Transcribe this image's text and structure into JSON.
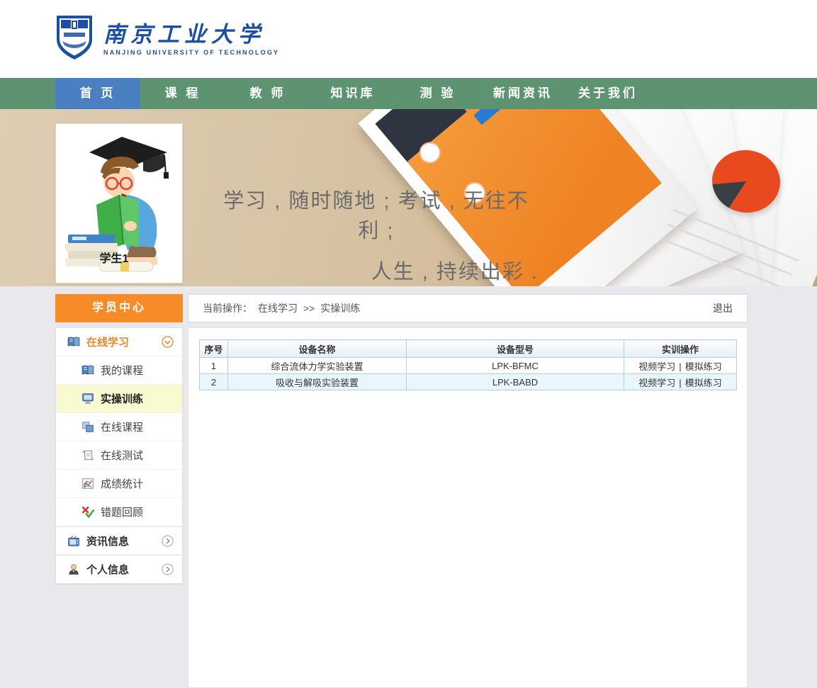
{
  "header": {
    "logo_cn": "南京工业大学",
    "logo_en": "NANJING UNIVERSITY OF TECHNOLOGY"
  },
  "nav": {
    "items": [
      {
        "label": "首 页",
        "active": true
      },
      {
        "label": "课 程",
        "active": false
      },
      {
        "label": "教 师",
        "active": false
      },
      {
        "label": "知识库",
        "active": false
      },
      {
        "label": "测 验",
        "active": false
      },
      {
        "label": "新闻资讯",
        "active": false
      },
      {
        "label": "关于我们",
        "active": false
      }
    ]
  },
  "banner": {
    "student_label": "学生1",
    "slogan_line1": "学习 , 随时随地 ; 考试 , 无往不利 ;",
    "slogan_line2": "人生 , 持续出彩 ."
  },
  "sidebar": {
    "title": "学员中心",
    "groups": [
      {
        "label": "在线学习",
        "icon": "open-book-icon",
        "expanded": true,
        "children": [
          {
            "label": "我的课程",
            "icon": "open-book-icon",
            "active": false
          },
          {
            "label": "实操训练",
            "icon": "monitor-icon",
            "active": true
          },
          {
            "label": "在线课程",
            "icon": "windows-icon",
            "active": false
          },
          {
            "label": "在线测试",
            "icon": "scroll-icon",
            "active": false
          },
          {
            "label": "成绩统计",
            "icon": "chart-icon",
            "active": false
          },
          {
            "label": "错题回顾",
            "icon": "review-check-icon",
            "active": false
          }
        ]
      },
      {
        "label": "资讯信息",
        "icon": "tv-icon",
        "expanded": false,
        "children": []
      },
      {
        "label": "个人信息",
        "icon": "person-icon",
        "expanded": false,
        "children": []
      }
    ]
  },
  "breadcrumb": {
    "label": "当前操作：",
    "section": "在线学习",
    "arrows": ">>",
    "current": "实操训练",
    "logout": "退出"
  },
  "table": {
    "headers": [
      "序号",
      "设备名称",
      "设备型号",
      "实训操作"
    ],
    "op_separator": "|",
    "rows": [
      {
        "no": "1",
        "name": "综合流体力学实验装置",
        "model": "LPK-BFMC",
        "op_video": "视频学习",
        "op_sim": "模拟练习"
      },
      {
        "no": "2",
        "name": "吸收与解吸实验装置",
        "model": "LPK-BABD",
        "op_video": "视频学习",
        "op_sim": "模拟练习"
      }
    ]
  },
  "colors": {
    "nav_green": "#5d9370",
    "nav_active_blue": "#4a7fc1",
    "accent_orange": "#f78b28",
    "online_orange_text": "#e8862a",
    "active_item_yellow": "#fafad2",
    "table_border_blue": "#b5cfe0",
    "table_alt_row": "#e9f7fd",
    "logo_blue": "#1c4fa1",
    "banner_tan": "#d6c2a2"
  }
}
